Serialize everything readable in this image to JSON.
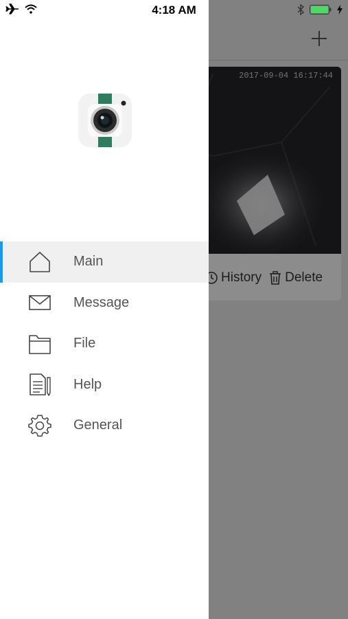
{
  "status_bar": {
    "time": "4:18 AM",
    "left_icons": [
      "airplane-icon",
      "wifi-icon"
    ],
    "right_icons": [
      "bluetooth-icon",
      "battery-icon",
      "charging-icon"
    ],
    "battery_color": "#4cd964"
  },
  "drawer": {
    "logo": "camera-app-icon",
    "accent_color": "#1a9be6",
    "menu": [
      {
        "label": "Main",
        "icon": "home-icon",
        "active": true
      },
      {
        "label": "Message",
        "icon": "envelope-icon",
        "active": false
      },
      {
        "label": "File",
        "icon": "folder-icon",
        "active": false
      },
      {
        "label": "Help",
        "icon": "document-pencil-icon",
        "active": false
      },
      {
        "label": "General",
        "icon": "gear-icon",
        "active": false
      }
    ]
  },
  "background_screen": {
    "add_icon": "plus-icon",
    "timestamp": "2017-09-04 16:17:44",
    "actions": [
      {
        "label": "History",
        "icon": "clock-icon"
      },
      {
        "label": "Delete",
        "icon": "trash-icon"
      }
    ]
  }
}
